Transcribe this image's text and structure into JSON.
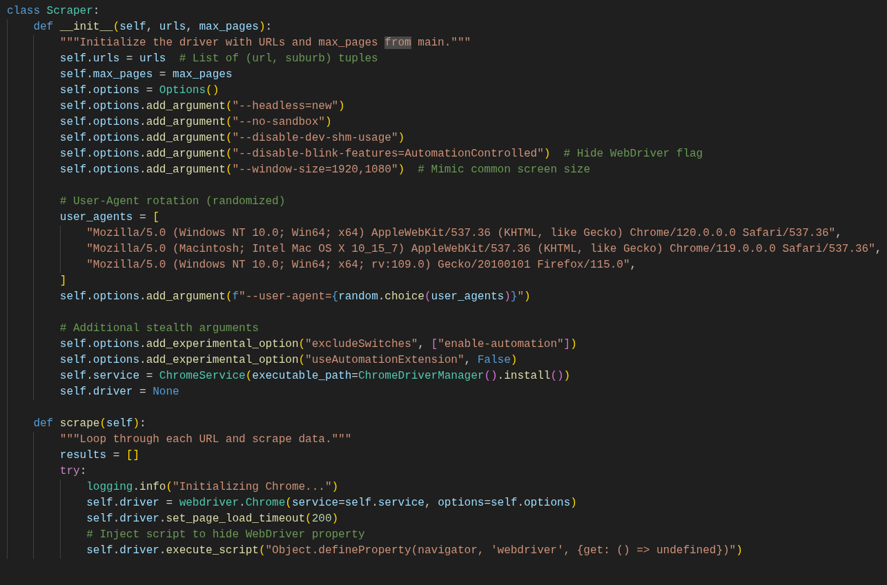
{
  "lines": [
    {
      "tokens": [
        {
          "kind": "kw",
          "text": "class "
        },
        {
          "kind": "cls",
          "text": "Scraper"
        },
        {
          "kind": "plain",
          "text": ":"
        }
      ]
    },
    {
      "tokens": [
        {
          "kind": "kw",
          "text": "    def "
        },
        {
          "kind": "fn",
          "text": "__init__"
        },
        {
          "kind": "b1",
          "text": "("
        },
        {
          "kind": "var",
          "text": "self"
        },
        {
          "kind": "plain",
          "text": ", "
        },
        {
          "kind": "var",
          "text": "urls"
        },
        {
          "kind": "plain",
          "text": ", "
        },
        {
          "kind": "var",
          "text": "max_pages"
        },
        {
          "kind": "b1",
          "text": ")"
        },
        {
          "kind": "plain",
          "text": ":"
        }
      ]
    },
    {
      "tokens": [
        {
          "kind": "str",
          "text": "        \"\"\"Initialize the driver with URLs and max_pages "
        },
        {
          "kind": "str",
          "text": "from",
          "match": true
        },
        {
          "kind": "str",
          "text": " main.\"\"\""
        }
      ]
    },
    {
      "tokens": [
        {
          "kind": "var",
          "text": "        self"
        },
        {
          "kind": "plain",
          "text": "."
        },
        {
          "kind": "var",
          "text": "urls"
        },
        {
          "kind": "plain",
          "text": " = "
        },
        {
          "kind": "var",
          "text": "urls"
        },
        {
          "kind": "com",
          "text": "  # List of (url, suburb) tuples"
        }
      ]
    },
    {
      "tokens": [
        {
          "kind": "var",
          "text": "        self"
        },
        {
          "kind": "plain",
          "text": "."
        },
        {
          "kind": "var",
          "text": "max_pages"
        },
        {
          "kind": "plain",
          "text": " = "
        },
        {
          "kind": "var",
          "text": "max_pages"
        }
      ]
    },
    {
      "tokens": [
        {
          "kind": "var",
          "text": "        self"
        },
        {
          "kind": "plain",
          "text": "."
        },
        {
          "kind": "var",
          "text": "options"
        },
        {
          "kind": "plain",
          "text": " = "
        },
        {
          "kind": "cls",
          "text": "Options"
        },
        {
          "kind": "b1",
          "text": "()"
        }
      ]
    },
    {
      "tokens": [
        {
          "kind": "var",
          "text": "        self"
        },
        {
          "kind": "plain",
          "text": "."
        },
        {
          "kind": "var",
          "text": "options"
        },
        {
          "kind": "plain",
          "text": "."
        },
        {
          "kind": "fn",
          "text": "add_argument"
        },
        {
          "kind": "b1",
          "text": "("
        },
        {
          "kind": "str",
          "text": "\"--headless=new\""
        },
        {
          "kind": "b1",
          "text": ")"
        }
      ]
    },
    {
      "tokens": [
        {
          "kind": "var",
          "text": "        self"
        },
        {
          "kind": "plain",
          "text": "."
        },
        {
          "kind": "var",
          "text": "options"
        },
        {
          "kind": "plain",
          "text": "."
        },
        {
          "kind": "fn",
          "text": "add_argument"
        },
        {
          "kind": "b1",
          "text": "("
        },
        {
          "kind": "str",
          "text": "\"--no-sandbox\""
        },
        {
          "kind": "b1",
          "text": ")"
        }
      ]
    },
    {
      "tokens": [
        {
          "kind": "var",
          "text": "        self"
        },
        {
          "kind": "plain",
          "text": "."
        },
        {
          "kind": "var",
          "text": "options"
        },
        {
          "kind": "plain",
          "text": "."
        },
        {
          "kind": "fn",
          "text": "add_argument"
        },
        {
          "kind": "b1",
          "text": "("
        },
        {
          "kind": "str",
          "text": "\"--disable-dev-shm-usage\""
        },
        {
          "kind": "b1",
          "text": ")"
        }
      ]
    },
    {
      "tokens": [
        {
          "kind": "var",
          "text": "        self"
        },
        {
          "kind": "plain",
          "text": "."
        },
        {
          "kind": "var",
          "text": "options"
        },
        {
          "kind": "plain",
          "text": "."
        },
        {
          "kind": "fn",
          "text": "add_argument"
        },
        {
          "kind": "b1",
          "text": "("
        },
        {
          "kind": "str",
          "text": "\"--disable-blink-features=AutomationControlled\""
        },
        {
          "kind": "b1",
          "text": ")"
        },
        {
          "kind": "com",
          "text": "  # Hide WebDriver flag"
        }
      ]
    },
    {
      "tokens": [
        {
          "kind": "var",
          "text": "        self"
        },
        {
          "kind": "plain",
          "text": "."
        },
        {
          "kind": "var",
          "text": "options"
        },
        {
          "kind": "plain",
          "text": "."
        },
        {
          "kind": "fn",
          "text": "add_argument"
        },
        {
          "kind": "b1",
          "text": "("
        },
        {
          "kind": "str",
          "text": "\"--window-size=1920,1080\""
        },
        {
          "kind": "b1",
          "text": ")"
        },
        {
          "kind": "com",
          "text": "  # Mimic common screen size"
        }
      ]
    },
    {
      "gap_before": true,
      "tokens": [
        {
          "kind": "com",
          "text": "        # User-Agent rotation (randomized)"
        }
      ]
    },
    {
      "tokens": [
        {
          "kind": "var",
          "text": "        user_agents"
        },
        {
          "kind": "plain",
          "text": " = "
        },
        {
          "kind": "b1",
          "text": "["
        }
      ]
    },
    {
      "tokens": [
        {
          "kind": "str",
          "text": "            \"Mozilla/5.0 (Windows NT 10.0; Win64; x64) AppleWebKit/537.36 (KHTML, like Gecko) Chrome/120.0.0.0 Safari/537.36\""
        },
        {
          "kind": "plain",
          "text": ","
        }
      ]
    },
    {
      "tokens": [
        {
          "kind": "str",
          "text": "            \"Mozilla/5.0 (Macintosh; Intel Mac OS X 10_15_7) AppleWebKit/537.36 (KHTML, like Gecko) Chrome/119.0.0.0 Safari/537.36\""
        },
        {
          "kind": "plain",
          "text": ","
        }
      ]
    },
    {
      "tokens": [
        {
          "kind": "str",
          "text": "            \"Mozilla/5.0 (Windows NT 10.0; Win64; x64; rv:109.0) Gecko/20100101 Firefox/115.0\""
        },
        {
          "kind": "plain",
          "text": ","
        }
      ]
    },
    {
      "tokens": [
        {
          "kind": "b1",
          "text": "        ]"
        }
      ]
    },
    {
      "tokens": [
        {
          "kind": "var",
          "text": "        self"
        },
        {
          "kind": "plain",
          "text": "."
        },
        {
          "kind": "var",
          "text": "options"
        },
        {
          "kind": "plain",
          "text": "."
        },
        {
          "kind": "fn",
          "text": "add_argument"
        },
        {
          "kind": "b1",
          "text": "("
        },
        {
          "kind": "kw",
          "text": "f"
        },
        {
          "kind": "str",
          "text": "\"--user-agent="
        },
        {
          "kind": "kw",
          "text": "{"
        },
        {
          "kind": "var",
          "text": "random"
        },
        {
          "kind": "plain",
          "text": "."
        },
        {
          "kind": "fn",
          "text": "choice"
        },
        {
          "kind": "b2",
          "text": "("
        },
        {
          "kind": "var",
          "text": "user_agents"
        },
        {
          "kind": "b2",
          "text": ")"
        },
        {
          "kind": "kw",
          "text": "}"
        },
        {
          "kind": "str",
          "text": "\""
        },
        {
          "kind": "b1",
          "text": ")"
        }
      ]
    },
    {
      "gap_before": true,
      "tokens": [
        {
          "kind": "com",
          "text": "        # Additional stealth arguments"
        }
      ]
    },
    {
      "tokens": [
        {
          "kind": "var",
          "text": "        self"
        },
        {
          "kind": "plain",
          "text": "."
        },
        {
          "kind": "var",
          "text": "options"
        },
        {
          "kind": "plain",
          "text": "."
        },
        {
          "kind": "fn",
          "text": "add_experimental_option"
        },
        {
          "kind": "b1",
          "text": "("
        },
        {
          "kind": "str",
          "text": "\"excludeSwitches\""
        },
        {
          "kind": "plain",
          "text": ", "
        },
        {
          "kind": "b2",
          "text": "["
        },
        {
          "kind": "str",
          "text": "\"enable-automation\""
        },
        {
          "kind": "b2",
          "text": "]"
        },
        {
          "kind": "b1",
          "text": ")"
        }
      ]
    },
    {
      "tokens": [
        {
          "kind": "var",
          "text": "        self"
        },
        {
          "kind": "plain",
          "text": "."
        },
        {
          "kind": "var",
          "text": "options"
        },
        {
          "kind": "plain",
          "text": "."
        },
        {
          "kind": "fn",
          "text": "add_experimental_option"
        },
        {
          "kind": "b1",
          "text": "("
        },
        {
          "kind": "str",
          "text": "\"useAutomationExtension\""
        },
        {
          "kind": "plain",
          "text": ", "
        },
        {
          "kind": "kw",
          "text": "False"
        },
        {
          "kind": "b1",
          "text": ")"
        }
      ]
    },
    {
      "tokens": [
        {
          "kind": "var",
          "text": "        self"
        },
        {
          "kind": "plain",
          "text": "."
        },
        {
          "kind": "var",
          "text": "service"
        },
        {
          "kind": "plain",
          "text": " = "
        },
        {
          "kind": "cls",
          "text": "ChromeService"
        },
        {
          "kind": "b1",
          "text": "("
        },
        {
          "kind": "var",
          "text": "executable_path"
        },
        {
          "kind": "plain",
          "text": "="
        },
        {
          "kind": "cls",
          "text": "ChromeDriverManager"
        },
        {
          "kind": "b2",
          "text": "()"
        },
        {
          "kind": "plain",
          "text": "."
        },
        {
          "kind": "fn",
          "text": "install"
        },
        {
          "kind": "b2",
          "text": "()"
        },
        {
          "kind": "b1",
          "text": ")"
        }
      ]
    },
    {
      "tokens": [
        {
          "kind": "var",
          "text": "        self"
        },
        {
          "kind": "plain",
          "text": "."
        },
        {
          "kind": "var",
          "text": "driver"
        },
        {
          "kind": "plain",
          "text": " = "
        },
        {
          "kind": "kw",
          "text": "None"
        }
      ]
    },
    {
      "gap_before": true,
      "tokens": [
        {
          "kind": "kw",
          "text": "    def "
        },
        {
          "kind": "fn",
          "text": "scrape"
        },
        {
          "kind": "b1",
          "text": "("
        },
        {
          "kind": "var",
          "text": "self"
        },
        {
          "kind": "b1",
          "text": ")"
        },
        {
          "kind": "plain",
          "text": ":"
        }
      ]
    },
    {
      "tokens": [
        {
          "kind": "str",
          "text": "        \"\"\"Loop through each URL and scrape data.\"\"\""
        }
      ]
    },
    {
      "tokens": [
        {
          "kind": "var",
          "text": "        results"
        },
        {
          "kind": "plain",
          "text": " = "
        },
        {
          "kind": "b1",
          "text": "[]"
        }
      ]
    },
    {
      "tokens": [
        {
          "kind": "ctrl",
          "text": "        try"
        },
        {
          "kind": "plain",
          "text": ":"
        }
      ]
    },
    {
      "tokens": [
        {
          "kind": "cls",
          "text": "            logging"
        },
        {
          "kind": "plain",
          "text": "."
        },
        {
          "kind": "fn",
          "text": "info"
        },
        {
          "kind": "b1",
          "text": "("
        },
        {
          "kind": "str",
          "text": "\"Initializing Chrome...\""
        },
        {
          "kind": "b1",
          "text": ")"
        }
      ]
    },
    {
      "tokens": [
        {
          "kind": "var",
          "text": "            self"
        },
        {
          "kind": "plain",
          "text": "."
        },
        {
          "kind": "var",
          "text": "driver"
        },
        {
          "kind": "plain",
          "text": " = "
        },
        {
          "kind": "cls",
          "text": "webdriver"
        },
        {
          "kind": "plain",
          "text": "."
        },
        {
          "kind": "cls",
          "text": "Chrome"
        },
        {
          "kind": "b1",
          "text": "("
        },
        {
          "kind": "var",
          "text": "service"
        },
        {
          "kind": "plain",
          "text": "="
        },
        {
          "kind": "var",
          "text": "self"
        },
        {
          "kind": "plain",
          "text": "."
        },
        {
          "kind": "var",
          "text": "service"
        },
        {
          "kind": "plain",
          "text": ", "
        },
        {
          "kind": "var",
          "text": "options"
        },
        {
          "kind": "plain",
          "text": "="
        },
        {
          "kind": "var",
          "text": "self"
        },
        {
          "kind": "plain",
          "text": "."
        },
        {
          "kind": "var",
          "text": "options"
        },
        {
          "kind": "b1",
          "text": ")"
        }
      ]
    },
    {
      "tokens": [
        {
          "kind": "var",
          "text": "            self"
        },
        {
          "kind": "plain",
          "text": "."
        },
        {
          "kind": "var",
          "text": "driver"
        },
        {
          "kind": "plain",
          "text": "."
        },
        {
          "kind": "fn",
          "text": "set_page_load_timeout"
        },
        {
          "kind": "b1",
          "text": "("
        },
        {
          "kind": "num",
          "text": "200"
        },
        {
          "kind": "b1",
          "text": ")"
        }
      ]
    },
    {
      "tokens": [
        {
          "kind": "com",
          "text": "            # Inject script to hide WebDriver property"
        }
      ]
    },
    {
      "tokens": [
        {
          "kind": "var",
          "text": "            self"
        },
        {
          "kind": "plain",
          "text": "."
        },
        {
          "kind": "var",
          "text": "driver"
        },
        {
          "kind": "plain",
          "text": "."
        },
        {
          "kind": "fn",
          "text": "execute_script"
        },
        {
          "kind": "b1",
          "text": "("
        },
        {
          "kind": "str",
          "text": "\"Object.defineProperty(navigator, 'webdriver', {get: () => undefined})\""
        },
        {
          "kind": "b1",
          "text": ")"
        }
      ]
    }
  ]
}
